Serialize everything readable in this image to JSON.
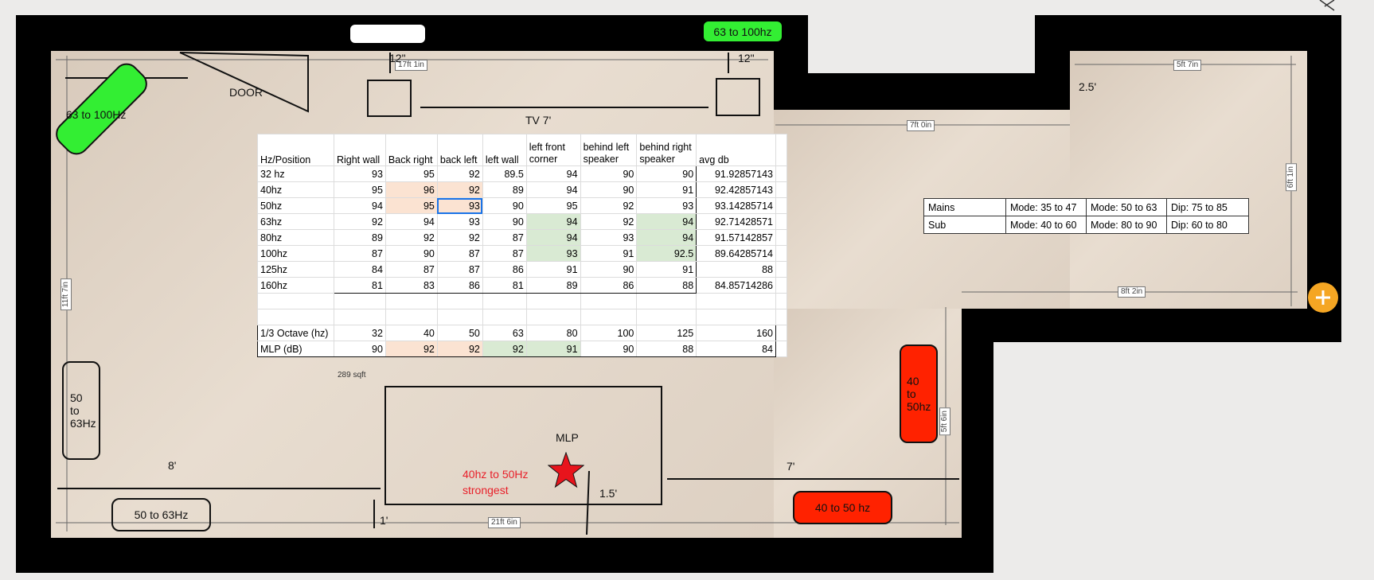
{
  "floorplan": {
    "dimensions": {
      "top_left": "17ft 1in",
      "top_right": "5ft 7in",
      "passage": "7ft 0in",
      "left_height": "11ft 7in",
      "right_height": "6ft 1in",
      "right_lower": "8ft 2in",
      "bottom": "21ft 6in",
      "right_wall": "5ft 6in",
      "area": "289 sqft"
    },
    "labels": {
      "door": "DOOR",
      "tv": "TV 7'",
      "speaker_offset_left": "12\"",
      "speaker_offset_right": "12\"",
      "right_wing_offset": "2.5'",
      "left_dist": "8'",
      "right_dist": "7'",
      "mlp_offset": "1.5'",
      "bottom_offset": "1'",
      "mlp": "MLP",
      "strongest_line1": "40hz to 50Hz",
      "strongest_line2": "strongest"
    },
    "speakers": {
      "top_right_green": "63 to 100hz",
      "top_left_green": "63 to 100Hz",
      "left_outline": "50\nto\n63Hz",
      "bottom_left_outline": "50 to 63Hz",
      "right_red": "40\nto\n50hz",
      "bottom_red": "40 to 50 hz"
    }
  },
  "spreadsheet": {
    "headers": [
      "Hz/Position",
      "Right wall",
      "Back right",
      "back left",
      "left wall",
      "left front corner",
      "behind left speaker",
      "behind right speaker",
      "avg db"
    ],
    "rows": [
      {
        "hz": "32 hz",
        "values": [
          "93",
          "95",
          "92",
          "89.5",
          "94",
          "90",
          "90"
        ],
        "avg": "91.92857143"
      },
      {
        "hz": "40hz",
        "values": [
          "95",
          "96",
          "92",
          "89",
          "94",
          "90",
          "91"
        ],
        "avg": "92.42857143"
      },
      {
        "hz": "50hz",
        "values": [
          "94",
          "95",
          "93",
          "90",
          "95",
          "92",
          "93"
        ],
        "avg": "93.14285714"
      },
      {
        "hz": "63hz",
        "values": [
          "92",
          "94",
          "93",
          "90",
          "94",
          "92",
          "94"
        ],
        "avg": "92.71428571"
      },
      {
        "hz": "80hz",
        "values": [
          "89",
          "92",
          "92",
          "87",
          "94",
          "93",
          "94"
        ],
        "avg": "91.57142857"
      },
      {
        "hz": "100hz",
        "values": [
          "87",
          "90",
          "87",
          "87",
          "93",
          "91",
          "92.5"
        ],
        "avg": "89.64285714"
      },
      {
        "hz": "125hz",
        "values": [
          "84",
          "87",
          "87",
          "86",
          "91",
          "90",
          "91"
        ],
        "avg": "88"
      },
      {
        "hz": "160hz",
        "values": [
          "81",
          "83",
          "86",
          "81",
          "89",
          "86",
          "88"
        ],
        "avg": "84.85714286"
      }
    ],
    "octave_label": "1/3 Octave (hz)",
    "octave": [
      "32",
      "40",
      "50",
      "63",
      "80",
      "100",
      "125",
      "160"
    ],
    "mlp_label": "MLP (dB)",
    "mlp": [
      "90",
      "92",
      "92",
      "92",
      "91",
      "90",
      "88",
      "84"
    ]
  },
  "modes_table": {
    "rows": [
      [
        "Mains",
        "Mode: 35 to 47",
        "Mode:  50 to 63",
        "Dip: 75 to 85"
      ],
      [
        "Sub",
        "Mode:  40 to 60",
        "Mode:  80 to 90",
        "Dip: 60 to 80"
      ]
    ]
  },
  "colors": {
    "wall": "#000000",
    "speaker_green": "#33ee33",
    "speaker_red": "#ff2200",
    "highlight_orange": "#fbe3d2",
    "highlight_green": "#d9ead3",
    "add_button": "#f5a623",
    "selection": "#1a73e8"
  },
  "icons": {
    "add": "plus-circle-icon",
    "close": "close-icon",
    "mlp_marker": "star-icon"
  }
}
